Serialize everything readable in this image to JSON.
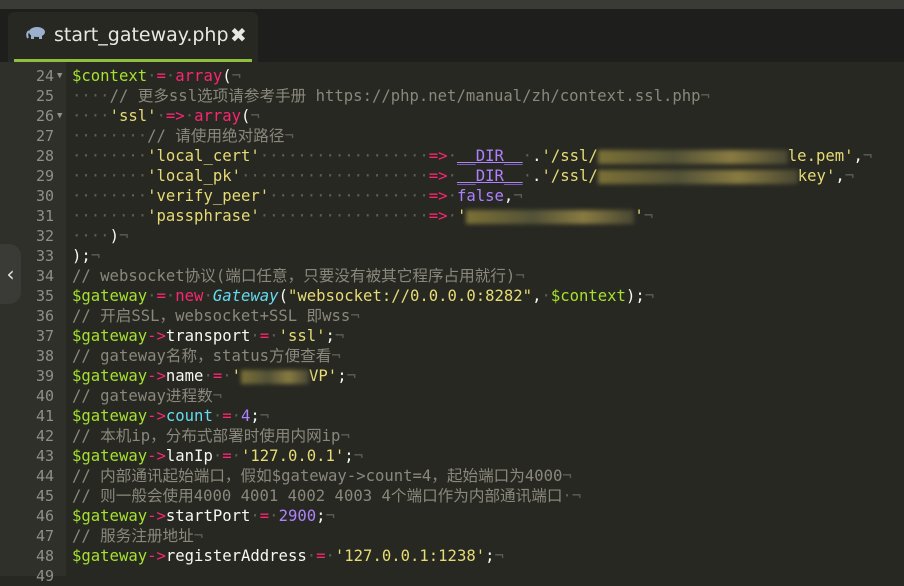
{
  "tab": {
    "title": "start_gateway.php",
    "close_glyph": "✖",
    "icon": "php-elephant-icon"
  },
  "side_handle": {
    "glyph": "‹"
  },
  "line_numbers": [
    "24",
    "25",
    "26",
    "27",
    "28",
    "29",
    "30",
    "31",
    "32",
    "33",
    "34",
    "35",
    "36",
    "37",
    "38",
    "39",
    "40",
    "41",
    "42",
    "43",
    "44",
    "45",
    "46",
    "47",
    "48",
    "49"
  ],
  "code": {
    "l24": {
      "var": "$context",
      "eq": "=",
      "fn": "array",
      "paren": "("
    },
    "l25": {
      "comment": "// 更多ssl选项请参考手册 https://php.net/manual/zh/context.ssl.php"
    },
    "l26": {
      "key": "'ssl'",
      "arrow": "=>",
      "fn": "array",
      "paren": "("
    },
    "l27": {
      "comment": "// 请使用绝对路径"
    },
    "l28": {
      "key": "'local_cert'",
      "arrow": "=>",
      "magic": "__DIR__",
      "dot": ".",
      "str_start": "'/ssl/",
      "str_end": "le.pem'",
      "comma": ","
    },
    "l29": {
      "key": "'local_pk'",
      "arrow": "=>",
      "magic": "__DIR__",
      "dot": ".",
      "str_start": "'/ssl/",
      "str_end": "key'",
      "comma": ","
    },
    "l30": {
      "key": "'verify_peer'",
      "arrow": "=>",
      "value": "false",
      "comma": ","
    },
    "l31": {
      "key": "'passphrase'",
      "arrow": "=>",
      "str_start": "'",
      "str_end": "'"
    },
    "l32": {
      "paren": ")"
    },
    "l33": {
      "text": ");"
    },
    "l34": {
      "comment": "// websocket协议(端口任意，只要没有被其它程序占用就行)"
    },
    "l35": {
      "var": "$gateway",
      "eq": "=",
      "kw": "new",
      "cls": "Gateway",
      "open": "(",
      "str": "\"websocket://0.0.0.0:8282\"",
      "sep": ",",
      "var2": "$context",
      "close": ");"
    },
    "l36": {
      "comment": "// 开启SSL，websocket+SSL 即wss"
    },
    "l37": {
      "var": "$gateway",
      "arrow": "->",
      "prop": "transport",
      "eq": "=",
      "str": "'ssl'",
      "end": ";"
    },
    "l38": {
      "comment": "// gateway名称，status方便查看"
    },
    "l39": {
      "var": "$gateway",
      "arrow": "->",
      "prop": "name",
      "eq": "=",
      "str_start": "'",
      "str_end": "VP'",
      "end": ";"
    },
    "l40": {
      "comment": "// gateway进程数"
    },
    "l41": {
      "var": "$gateway",
      "arrow": "->",
      "prop": "count",
      "eq": "=",
      "num": "4",
      "end": ";"
    },
    "l42": {
      "comment": "// 本机ip，分布式部署时使用内网ip"
    },
    "l43": {
      "var": "$gateway",
      "arrow": "->",
      "prop": "lanIp",
      "eq": "=",
      "str": "'127.0.0.1'",
      "end": ";"
    },
    "l44": {
      "comment": "// 内部通讯起始端口，假如$gateway->count=4，起始端口为4000"
    },
    "l45": {
      "comment": "// 则一般会使用4000 4001 4002 4003 4个端口作为内部通讯端口"
    },
    "l46": {
      "var": "$gateway",
      "arrow": "->",
      "prop": "startPort",
      "eq": "=",
      "num": "2900",
      "end": ";"
    },
    "l47": {
      "comment": "// 服务注册地址"
    },
    "l48": {
      "var": "$gateway",
      "arrow": "->",
      "prop": "registerAddress",
      "eq": "=",
      "str": "'127.0.0.1:1238'",
      "end": ";"
    }
  },
  "colors": {
    "background": "#272822",
    "variable": "#a6e22e",
    "operator": "#f92672",
    "string": "#e6db74",
    "comment": "#8a887c",
    "class": "#66d9ef",
    "number": "#ae81ff",
    "tab_underline": "#8fbf3f"
  }
}
